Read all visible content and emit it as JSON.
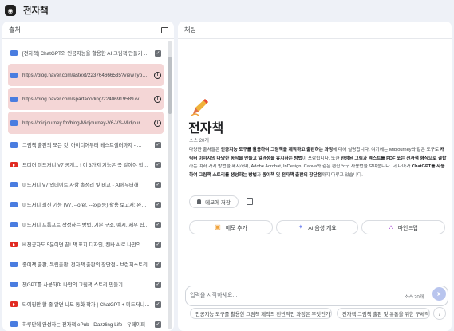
{
  "app": {
    "title": "전자책",
    "logo": "notebooklm-logo"
  },
  "sources_panel": {
    "title": "출처",
    "toggle_icon": "panel-toggle-icon",
    "items": [
      {
        "text": "[전자책] ChatGPT와 인공지능을 활용한 AI 그림책 만들기 …",
        "icon": "doc-icon",
        "state": "checked"
      },
      {
        "text": "https://blog.naver.com/astext/223764666535?viewTyp…",
        "icon": "link-icon",
        "state": "error"
      },
      {
        "text": "https://blog.naver.com/spartacoding/224069195897v…",
        "icon": "link-icon",
        "state": "error"
      },
      {
        "text": "https://midjourney.fm/blog-Midjourney-V6-VS-Midjour…",
        "icon": "link-icon",
        "state": "error"
      },
      {
        "text": "그림책 출판의 모든 것: 아이디어부터 베스트셀러까지 - …",
        "icon": "blog-icon",
        "state": "checked"
      },
      {
        "text": "드디어 미드저니 V7 공개... ! 이 3가지 기능은 꼭 알아야 합니…",
        "icon": "youtube-icon",
        "state": "checked"
      },
      {
        "text": "미드저니 V7 업데이트 사항 총정리 및 비교 - AI에부터해",
        "icon": "blog-icon",
        "state": "checked"
      },
      {
        "text": "미드저니 최신 기능 (V7, --oref, --exp 등) 활용 보고서: 완…",
        "icon": "doc-icon",
        "state": "checked"
      },
      {
        "text": "미드저니 프롬프트 작성하는 방법, 기본 구조, 예시, 세부 팁…",
        "icon": "blog-icon",
        "state": "checked"
      },
      {
        "text": "비전공자도 5분이면 끝! 책 표지 디자인, 캔바 AI로 나만의 …",
        "icon": "youtube-icon",
        "state": "checked"
      },
      {
        "text": "종이책 출판, 독립출판, 전자책 출판의 장단점 - 브런치스토리",
        "icon": "blog-icon",
        "state": "checked"
      },
      {
        "text": "챗GPT를 사용하여 나만의 그림책 스토리 만들기",
        "icon": "blog-icon",
        "state": "checked"
      },
      {
        "text": "타이핑만 할 줄 알면 나도 동화 작가 | ChatGPT + 미드저니…",
        "icon": "youtube-icon",
        "state": "checked"
      },
      {
        "text": "하루만에 완성하는 전자책 ePub - Dazzling Life - 유페이퍼",
        "icon": "blog-icon",
        "state": "checked"
      }
    ]
  },
  "chat_panel": {
    "title": "채팅",
    "notebook": {
      "emoji": "pen-icon",
      "title": "전자책",
      "source_count": "소스 20개",
      "summary_parts": [
        {
          "t": "다양한 출처들은 ",
          "b": false
        },
        {
          "t": "인공지능 도구를 활용하여 그림책을 제작하고 출판하는 과정",
          "b": true
        },
        {
          "t": "에 대해 설명합니다. 여기에는 Midjourney와 같은 도구로 ",
          "b": false
        },
        {
          "t": "캐릭터 이미지의 다양한 동작을 만들고 일관성을 유지하는 방법",
          "b": true
        },
        {
          "t": "이 포함됩니다. 또한 ",
          "b": false
        },
        {
          "t": "완성된 그림과 텍스트를 PDF 또는 전자책 형식으로 결합",
          "b": true
        },
        {
          "t": "하는 여러 가지 방법을 제시하며, Adobe Acrobat, InDesign, Canva와 같은 편집 도구 사용법을 보여줍니다. 더 나아가 ",
          "b": false
        },
        {
          "t": "ChatGPT를 사용하여 그림책 스토리를 생성하는 방법",
          "b": true
        },
        {
          "t": "과 ",
          "b": false
        },
        {
          "t": "종이책 및 전자책 출판의 장단점",
          "b": true
        },
        {
          "t": "까지 다루고 있습니다.",
          "b": false
        }
      ]
    },
    "save_note_label": "메모에 저장",
    "actions": [
      {
        "label": "메모 추가",
        "icon": "note-add-icon"
      },
      {
        "label": "AI 음성 개요",
        "icon": "sparkle-icon"
      },
      {
        "label": "마인드맵",
        "icon": "mindmap-icon"
      }
    ],
    "input": {
      "placeholder": "입력을 시작하세요...",
      "value": "",
      "source_count": "소스 20개"
    },
    "suggestions": [
      "인공지능 도구를 활용한 그림책 제작의 전반적인 과정은 무엇인가?",
      "전자책 그림책 출판 및 유통을 위한 구체적인 방법은?"
    ]
  },
  "colors": {
    "highlight_error": "#f4d6d6",
    "background": "#eef1f7",
    "send_button": "#b9c5ee"
  }
}
